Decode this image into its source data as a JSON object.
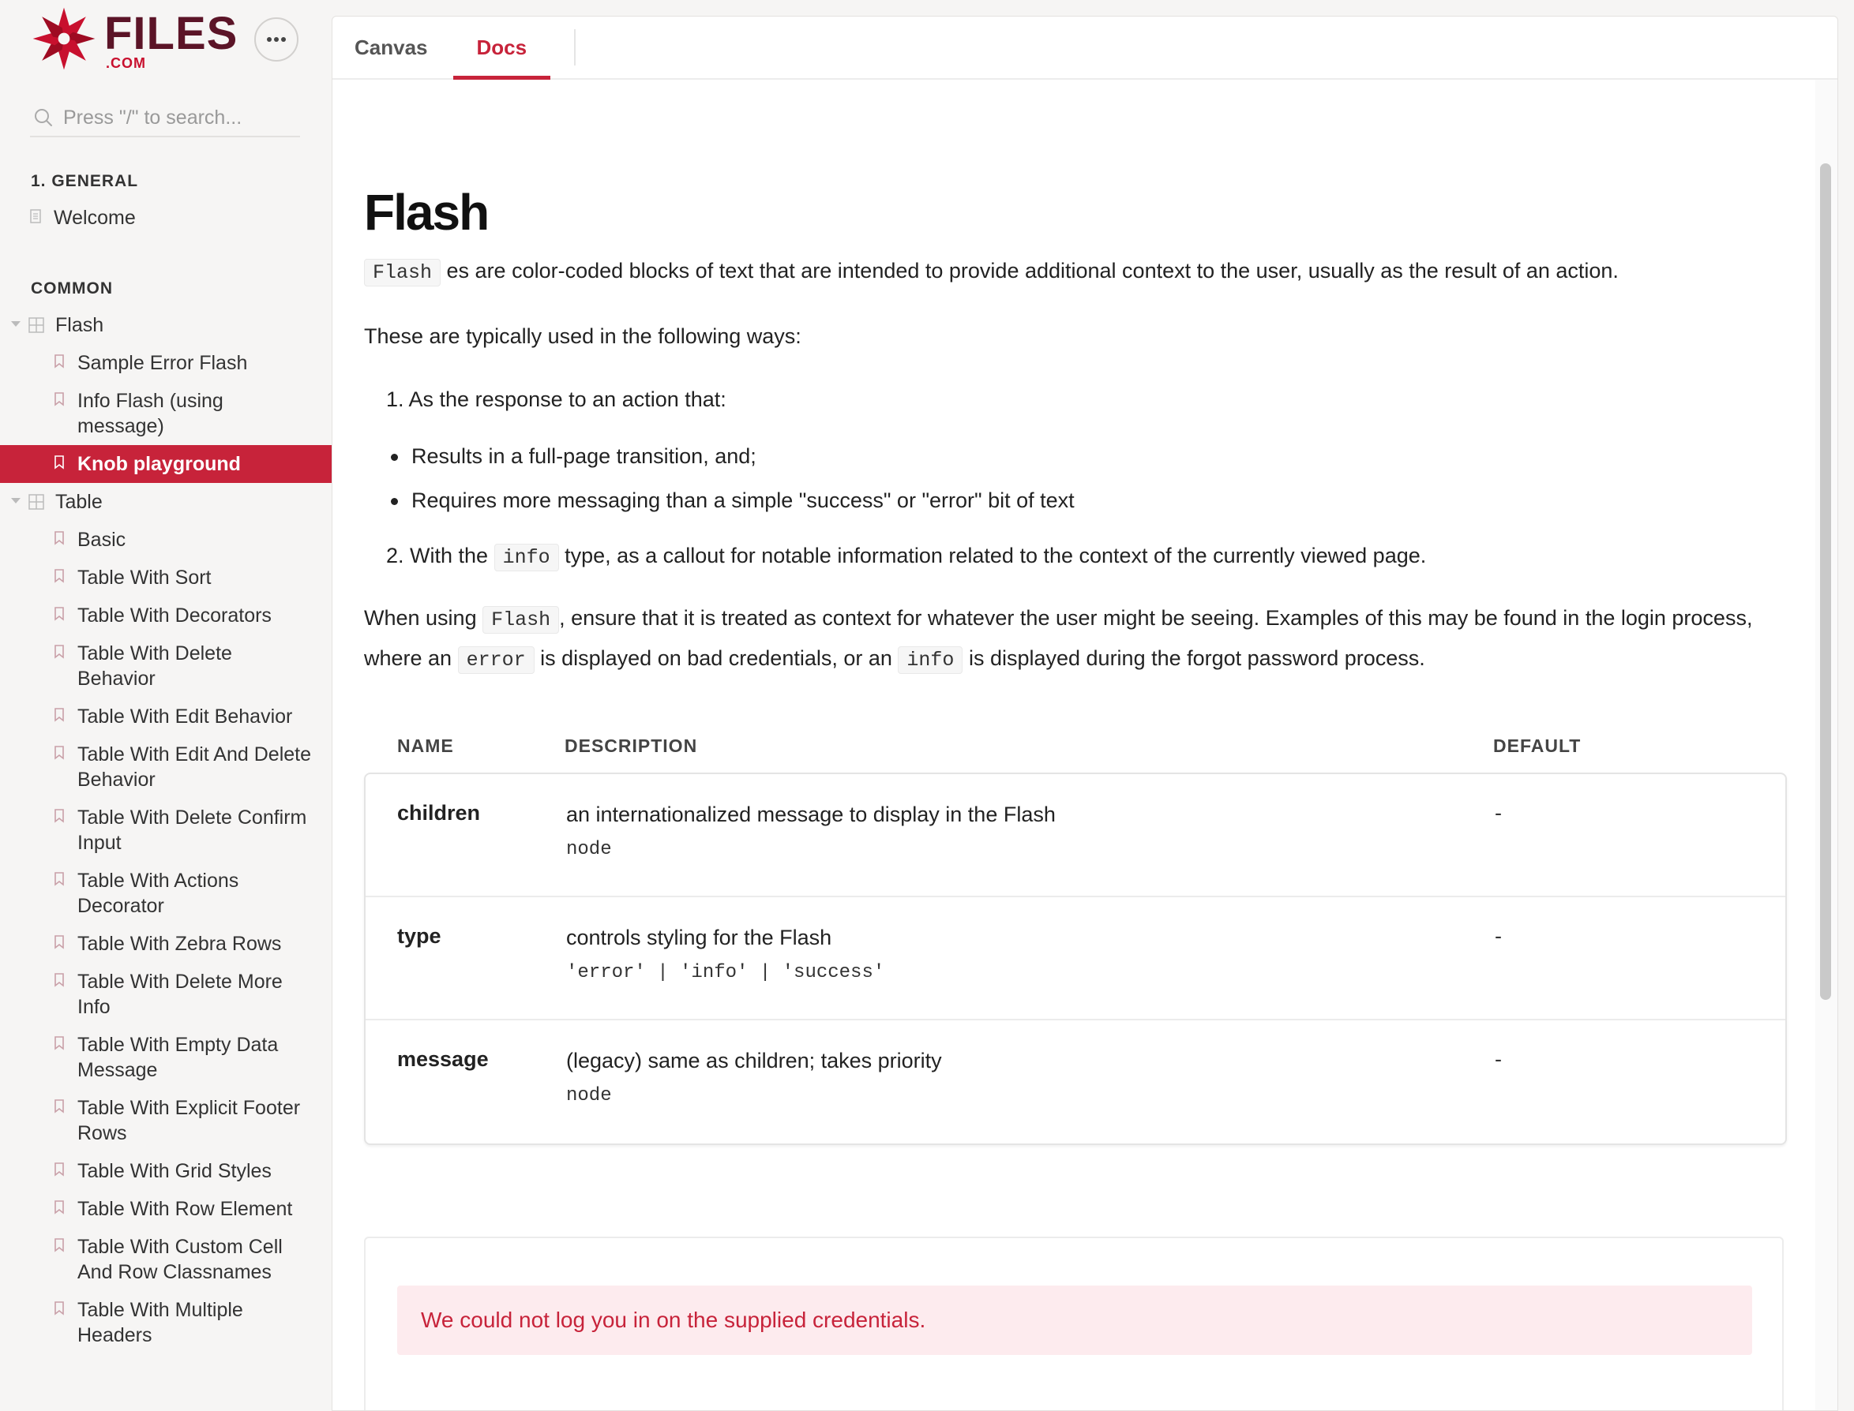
{
  "brand": {
    "name": "FILES",
    "suffix": ".COM",
    "more_icon": "more-horizontal-icon"
  },
  "search": {
    "placeholder": "Press \"/\" to search..."
  },
  "sidebar": {
    "general_heading": "1. GENERAL",
    "welcome": "Welcome",
    "common_heading": "COMMON",
    "flash_section": "Flash",
    "flash_items": [
      "Sample Error Flash",
      "Info Flash (using message)",
      "Knob playground"
    ],
    "table_section": "Table",
    "table_items": [
      "Basic",
      "Table With Sort",
      "Table With Decorators",
      "Table With Delete Behavior",
      "Table With Edit Behavior",
      "Table With Edit And Delete Behavior",
      "Table With Delete Confirm Input",
      "Table With Actions Decorator",
      "Table With Zebra Rows",
      "Table With Delete More Info",
      "Table With Empty Data Message",
      "Table With Explicit Footer Rows",
      "Table With Grid Styles",
      "Table With Row Element",
      "Table With Custom Cell And Row Classnames",
      "Table With Multiple Headers"
    ],
    "active_item": "Knob playground"
  },
  "tabs": {
    "canvas": "Canvas",
    "docs": "Docs",
    "active": "Docs"
  },
  "doc": {
    "title": "Flash",
    "intro_code": "Flash",
    "intro_rest": "es are color-coded blocks of text that are intended to provide additional context to the user, usually as the result of an action.",
    "usage_lead": "These are typically used in the following ways:",
    "ol1": "1. As the response to an action that:",
    "bullets": [
      "Results in a full-page transition, and;",
      "Requires more messaging than a simple \"success\" or \"error\" bit of text"
    ],
    "ol2_pre": "2. With the",
    "ol2_code": "info",
    "ol2_post": "type, as a callout for notable information related to the context of the currently viewed page.",
    "p3_a": "When using",
    "p3_code1": "Flash",
    "p3_b": ", ensure that it is treated as context for whatever the user might be seeing. Examples of this may be found in the login process, where an",
    "p3_code2": "error",
    "p3_c": "is displayed on bad credentials, or an",
    "p3_code3": "info",
    "p3_d": "is displayed during the forgot password process."
  },
  "props": {
    "headers": {
      "name": "NAME",
      "description": "DESCRIPTION",
      "default": "DEFAULT"
    },
    "rows": [
      {
        "name": "children",
        "description": "an internationalized message to display in the Flash",
        "type": "node",
        "default": "-"
      },
      {
        "name": "type",
        "description": "controls styling for the Flash",
        "type": "'error' | 'info' | 'success'",
        "default": "-"
      },
      {
        "name": "message",
        "description": "(legacy) same as children; takes priority",
        "type": "node",
        "default": "-"
      }
    ]
  },
  "preview": {
    "flash_message": "We could not log you in on the supplied credentials."
  },
  "colors": {
    "accent": "#c7233a",
    "brand_dark": "#5b1427",
    "flash_bg": "#fdebee"
  }
}
